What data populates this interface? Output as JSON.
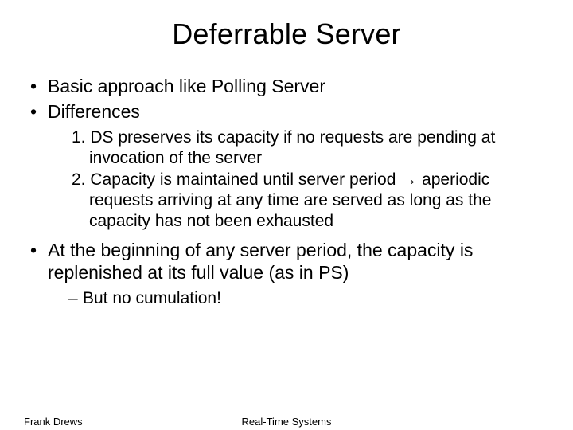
{
  "title": "Deferrable Server",
  "bullets": {
    "b1": "Basic approach like Polling Server",
    "b2": "Differences",
    "num1": "1. DS preserves its capacity if no requests are pending at invocation of the server",
    "num2_pre": "2. Capacity is maintained until server period ",
    "arrow": "→",
    "num2_post": " aperiodic requests arriving at any time are served as long as the capacity has not been exhausted",
    "b3": "At the beginning of any server period, the capacity is replenished at its full value (as in PS)",
    "dash1": "But no cumulation!"
  },
  "footer": {
    "left": "Frank Drews",
    "center": "Real-Time Systems"
  }
}
